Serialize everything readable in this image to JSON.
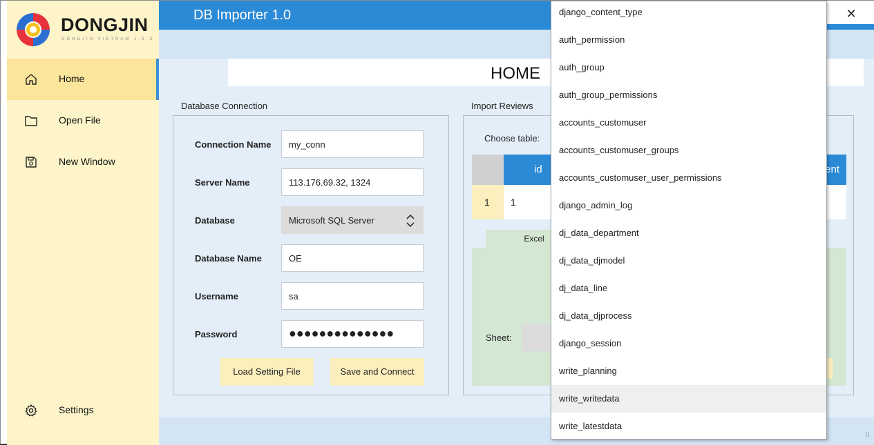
{
  "brand": {
    "name": "DONGJIN",
    "tagline": "DONGJIN VIETNAM J.S.C"
  },
  "app": {
    "title": "DB Importer 1.0",
    "close_glyph": "✕"
  },
  "sidebar": {
    "items": [
      {
        "label": "Home",
        "icon": "home-icon"
      },
      {
        "label": "Open File",
        "icon": "folder-icon"
      },
      {
        "label": "New Window",
        "icon": "save-icon"
      },
      {
        "label": "Settings",
        "icon": "gear-icon"
      }
    ]
  },
  "page": {
    "title": "HOME"
  },
  "connection": {
    "group_label": "Database Connection",
    "fields": {
      "connection_name": {
        "label": "Connection Name",
        "value": "my_conn"
      },
      "server_name": {
        "label": "Server Name",
        "value": "113.176.69.32, 1324"
      },
      "database": {
        "label": "Database",
        "value": "Microsoft SQL Server"
      },
      "database_name": {
        "label": "Database Name",
        "value": "OE"
      },
      "username": {
        "label": "Username",
        "value": "sa"
      },
      "password": {
        "label": "Password",
        "value": "●●●●●●●●●●●●●●"
      }
    },
    "buttons": {
      "load": "Load Setting File",
      "save": "Save and Connect"
    }
  },
  "import": {
    "group_label": "Import Reviews",
    "choose_table_label": "Choose table:",
    "table": {
      "columns": [
        "id",
        "ent"
      ],
      "rows": [
        {
          "index": "1",
          "id": "1"
        }
      ]
    },
    "tab_label": "Excel",
    "sheet_label": "Sheet:"
  },
  "dropdown": {
    "items": [
      "django_content_type",
      "auth_permission",
      "auth_group",
      "auth_group_permissions",
      "accounts_customuser",
      "accounts_customuser_groups",
      "accounts_customuser_user_permissions",
      "django_admin_log",
      "dj_data_department",
      "dj_data_djmodel",
      "dj_data_line",
      "dj_data_djprocess",
      "django_session",
      "write_planning",
      "write_writedata",
      "write_latestdata"
    ],
    "highlighted": "write_writedata"
  },
  "colors": {
    "accent": "#2b8ad6",
    "sidebar": "#fdf5c9",
    "active": "#fbe59a",
    "content": "#e3eef8"
  }
}
